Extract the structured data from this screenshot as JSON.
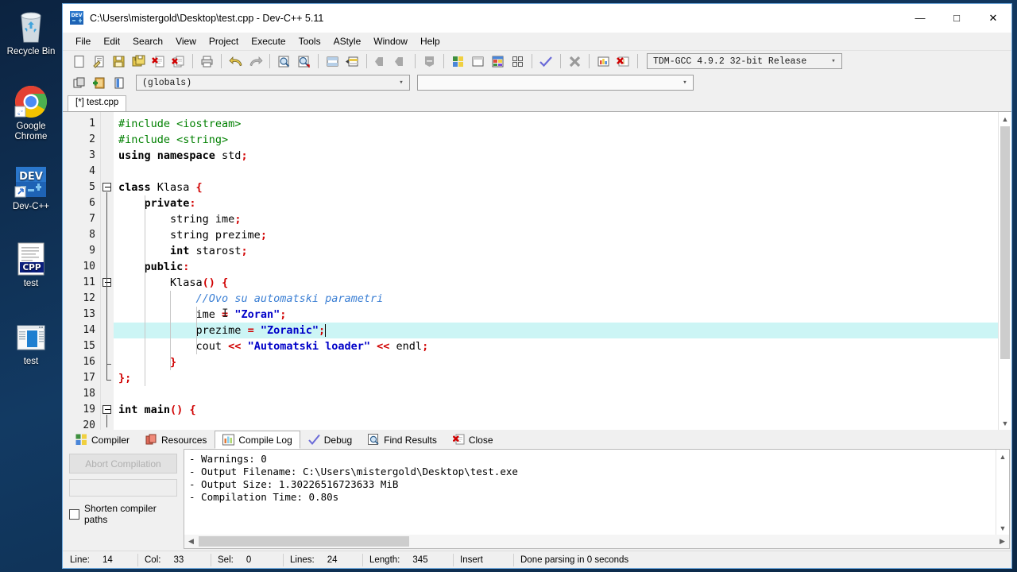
{
  "desktop": {
    "icons": [
      {
        "name": "recycle-bin",
        "label": "Recycle Bin"
      },
      {
        "name": "google-chrome",
        "label": "Google Chrome"
      },
      {
        "name": "dev-cpp",
        "label": "Dev-C++"
      },
      {
        "name": "test-cpp-file",
        "label": "test"
      },
      {
        "name": "test-exe-file",
        "label": "test"
      }
    ]
  },
  "window": {
    "title": "C:\\Users\\mistergold\\Desktop\\test.cpp - Dev-C++ 5.11",
    "icon": "dev-cpp-icon",
    "controls": {
      "minimize": "—",
      "maximize": "□",
      "close": "✕"
    }
  },
  "menubar": {
    "items": [
      "File",
      "Edit",
      "Search",
      "View",
      "Project",
      "Execute",
      "Tools",
      "AStyle",
      "Window",
      "Help"
    ]
  },
  "toolbar": {
    "group1": [
      "new-file-icon",
      "open-file-icon",
      "save-icon",
      "save-all-icon",
      "close-file-icon",
      "close-all-icon"
    ],
    "group2": [
      "print-icon"
    ],
    "group3": [
      "undo-icon",
      "redo-icon"
    ],
    "group4": [
      "find-icon",
      "find-next-icon"
    ],
    "group5": [
      "goto-line-icon",
      "replace-icon"
    ],
    "group6": [
      "back-icon",
      "forward-icon",
      "toggle-bookmark-icon"
    ],
    "group7": [
      "compile-icon",
      "run-icon",
      "compile-run-icon",
      "rebuild-all-icon"
    ],
    "group8": [
      "syntax-check-icon"
    ],
    "group9": [
      "remove-icon"
    ],
    "group10": [
      "profile-icon",
      "delete-profile-icon"
    ],
    "compiler_set": "TDM-GCC 4.9.2 32-bit Release",
    "row2_buttons": [
      "project-icon",
      "add-to-project-icon",
      "class-browser-icon"
    ],
    "scope": "(globals)",
    "member": ""
  },
  "editor": {
    "tab": "[*] test.cpp",
    "first_line": 1,
    "lines": [
      {
        "n": 1,
        "tokens": [
          {
            "t": "#include ",
            "c": "pp"
          },
          {
            "t": "<iostream>",
            "c": "pp"
          }
        ]
      },
      {
        "n": 2,
        "tokens": [
          {
            "t": "#include ",
            "c": "pp"
          },
          {
            "t": "<string>",
            "c": "pp"
          }
        ]
      },
      {
        "n": 3,
        "tokens": [
          {
            "t": "using namespace",
            "c": "k"
          },
          {
            "t": " std",
            "c": "id"
          },
          {
            "t": ";",
            "c": "sy"
          }
        ]
      },
      {
        "n": 4,
        "tokens": []
      },
      {
        "n": 5,
        "tokens": [
          {
            "t": "class",
            "c": "k"
          },
          {
            "t": " Klasa ",
            "c": "id"
          },
          {
            "t": "{",
            "c": "sy"
          }
        ]
      },
      {
        "n": 6,
        "tokens": [
          {
            "t": "    ",
            "c": "id"
          },
          {
            "t": "private",
            "c": "k"
          },
          {
            "t": ":",
            "c": "sy"
          }
        ]
      },
      {
        "n": 7,
        "tokens": [
          {
            "t": "        string ime",
            "c": "id"
          },
          {
            "t": ";",
            "c": "sy"
          }
        ]
      },
      {
        "n": 8,
        "tokens": [
          {
            "t": "        string prezime",
            "c": "id"
          },
          {
            "t": ";",
            "c": "sy"
          }
        ]
      },
      {
        "n": 9,
        "tokens": [
          {
            "t": "        ",
            "c": "id"
          },
          {
            "t": "int",
            "c": "k"
          },
          {
            "t": " starost",
            "c": "id"
          },
          {
            "t": ";",
            "c": "sy"
          }
        ]
      },
      {
        "n": 10,
        "tokens": [
          {
            "t": "    ",
            "c": "id"
          },
          {
            "t": "public",
            "c": "k"
          },
          {
            "t": ":",
            "c": "sy"
          }
        ]
      },
      {
        "n": 11,
        "tokens": [
          {
            "t": "        Klasa",
            "c": "id"
          },
          {
            "t": "()",
            "c": "sy"
          },
          {
            "t": " ",
            "c": "id"
          },
          {
            "t": "{",
            "c": "sy"
          }
        ]
      },
      {
        "n": 12,
        "tokens": [
          {
            "t": "            ",
            "c": "id"
          },
          {
            "t": "//Ovo su automatski parametri",
            "c": "cm"
          }
        ]
      },
      {
        "n": 13,
        "tokens": [
          {
            "t": "            ime ",
            "c": "id"
          },
          {
            "t": "=",
            "c": "sy"
          },
          {
            "t": " ",
            "c": "id"
          },
          {
            "t": "\"Zoran\"",
            "c": "st"
          },
          {
            "t": ";",
            "c": "sy"
          }
        ]
      },
      {
        "n": 14,
        "tokens": [
          {
            "t": "            prezime ",
            "c": "id"
          },
          {
            "t": "=",
            "c": "sy"
          },
          {
            "t": " ",
            "c": "id"
          },
          {
            "t": "\"Zoranic\"",
            "c": "st"
          },
          {
            "t": ";",
            "c": "sy"
          }
        ]
      },
      {
        "n": 15,
        "tokens": [
          {
            "t": "            cout ",
            "c": "id"
          },
          {
            "t": "<<",
            "c": "sy"
          },
          {
            "t": " ",
            "c": "id"
          },
          {
            "t": "\"Automatski loader\"",
            "c": "st"
          },
          {
            "t": " ",
            "c": "id"
          },
          {
            "t": "<<",
            "c": "sy"
          },
          {
            "t": " endl",
            "c": "id"
          },
          {
            "t": ";",
            "c": "sy"
          }
        ]
      },
      {
        "n": 16,
        "tokens": [
          {
            "t": "        ",
            "c": "id"
          },
          {
            "t": "}",
            "c": "sy"
          }
        ]
      },
      {
        "n": 17,
        "tokens": [
          {
            "t": "};",
            "c": "sy"
          }
        ]
      },
      {
        "n": 18,
        "tokens": []
      },
      {
        "n": 19,
        "tokens": [
          {
            "t": "int",
            "c": "k"
          },
          {
            "t": " ",
            "c": "id"
          },
          {
            "t": "main",
            "c": "k"
          },
          {
            "t": "()",
            "c": "sy"
          },
          {
            "t": " ",
            "c": "id"
          },
          {
            "t": "{",
            "c": "sy"
          }
        ]
      },
      {
        "n": 20,
        "tokens": []
      }
    ],
    "active_line": 14,
    "fold_lines": [
      5,
      11,
      19
    ]
  },
  "panel": {
    "tabs": [
      {
        "label": "Compiler",
        "icon": "compiler-icon",
        "selected": false
      },
      {
        "label": "Resources",
        "icon": "resources-icon",
        "selected": false
      },
      {
        "label": "Compile Log",
        "icon": "compile-log-icon",
        "selected": true
      },
      {
        "label": "Debug",
        "icon": "debug-icon",
        "selected": false
      },
      {
        "label": "Find Results",
        "icon": "find-results-icon",
        "selected": false
      },
      {
        "label": "Close",
        "icon": "close-panel-icon",
        "selected": false
      }
    ],
    "abort_label": "Abort Compilation",
    "progress_value": "",
    "shorten_label": "Shorten compiler paths",
    "shorten_checked": false,
    "log": [
      "- Warnings: 0",
      "- Output Filename: C:\\Users\\mistergold\\Desktop\\test.exe",
      "- Output Size: 1.30226516723633 MiB",
      "- Compilation Time: 0.80s"
    ]
  },
  "statusbar": {
    "line_key": "Line:",
    "line_value": "14",
    "col_key": "Col:",
    "col_value": "33",
    "sel_key": "Sel:",
    "sel_value": "0",
    "lines_key": "Lines:",
    "lines_value": "24",
    "length_key": "Length:",
    "length_value": "345",
    "mode": "Insert",
    "message": "Done parsing in 0 seconds"
  },
  "colors": {
    "accent": "#0078d7",
    "active_line": "#ccf5f5",
    "string": "#0000c8",
    "comment": "#3b7fd4",
    "symbol": "#d00000",
    "preprocessor": "#008000"
  }
}
